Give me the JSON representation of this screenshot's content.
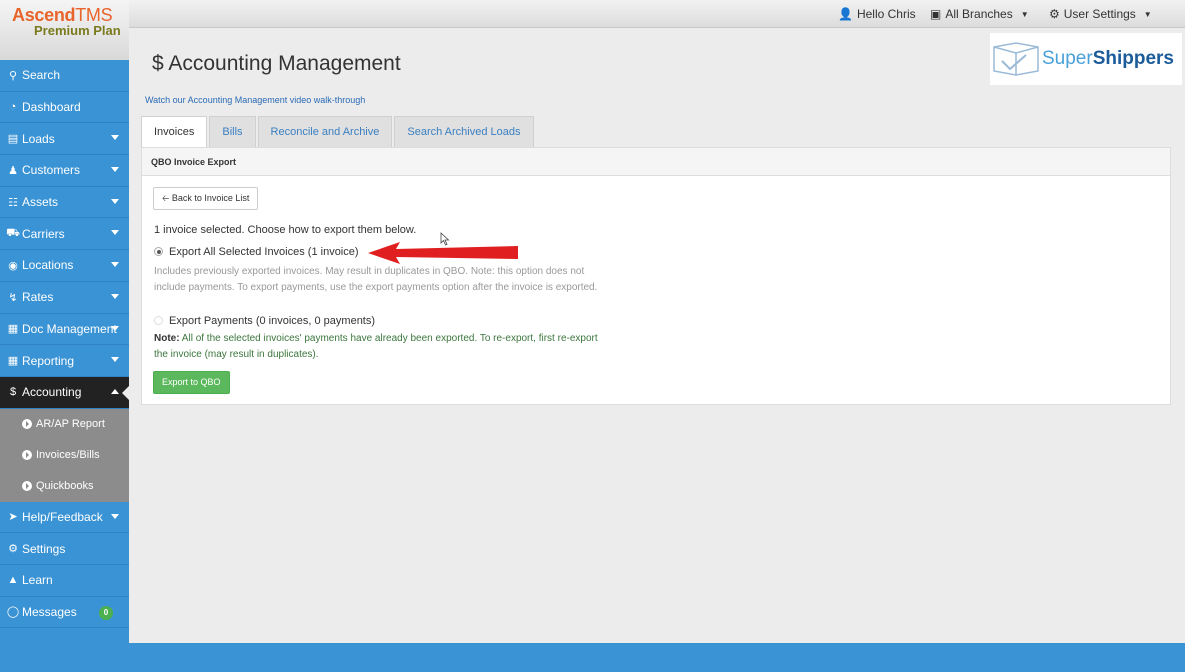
{
  "brand": {
    "name_main": "Ascend",
    "name_suffix": "TMS",
    "plan": "Premium Plan"
  },
  "topbar": {
    "greeting": "Hello Chris",
    "branches": "All Branches",
    "user_settings": "User Settings"
  },
  "sidebar": {
    "items": [
      {
        "label": "Search",
        "icon": "search-icon"
      },
      {
        "label": "Dashboard",
        "icon": "dashboard-icon"
      },
      {
        "label": "Loads",
        "icon": "list-icon"
      },
      {
        "label": "Customers",
        "icon": "users-icon"
      },
      {
        "label": "Assets",
        "icon": "barcode-icon"
      },
      {
        "label": "Carriers",
        "icon": "truck-icon"
      },
      {
        "label": "Locations",
        "icon": "map-marker-icon"
      },
      {
        "label": "Rates",
        "icon": "bolt-icon"
      },
      {
        "label": "Doc Management",
        "icon": "file-icon"
      },
      {
        "label": "Reporting",
        "icon": "report-icon"
      },
      {
        "label": "Accounting",
        "icon": "dollar-icon"
      }
    ],
    "sub_items": [
      {
        "label": "AR/AP Report"
      },
      {
        "label": "Invoices/Bills"
      },
      {
        "label": "Quickbooks"
      }
    ],
    "bottom_items": [
      {
        "label": "Help/Feedback",
        "icon": "bullhorn-icon"
      },
      {
        "label": "Settings",
        "icon": "gears-icon"
      },
      {
        "label": "Learn",
        "icon": "graduation-cap-icon"
      },
      {
        "label": "Messages",
        "icon": "comment-icon",
        "badge": "0"
      }
    ]
  },
  "main": {
    "title": "Accounting Management",
    "title_icon": "$",
    "partner_logo": {
      "part1": "Super",
      "part2": "Shippers"
    },
    "walkthrough_link": "Watch our Accounting Management video walk-through",
    "tabs": [
      {
        "label": "Invoices",
        "active": true
      },
      {
        "label": "Bills",
        "active": false
      },
      {
        "label": "Reconcile and Archive",
        "active": false
      },
      {
        "label": "Search Archived Loads",
        "active": false
      }
    ],
    "panel": {
      "heading": "QBO Invoice Export",
      "back_button": "Back to Invoice List",
      "selection_text": "1 invoice selected. Choose how to export them below.",
      "option1_label": "Export All Selected Invoices (1 invoice)",
      "option1_help": "Includes previously exported invoices. May result in duplicates in QBO. Note: this option does not include payments. To export payments, use the export payments option after the invoice is exported.",
      "option2_label": "Export Payments (0 invoices, 0 payments)",
      "option2_note_prefix": "Note:",
      "option2_note": "All of the selected invoices' payments have already been exported. To re-export, first re-export the invoice (may result in duplicates).",
      "export_button": "Export to QBO"
    }
  },
  "colors": {
    "sidebar": "#3a93d4",
    "active_nav": "#222222",
    "sub_nav": "#8c8c8c",
    "brand_orange": "#e8642b",
    "export_green": "#5cb85c",
    "arrow_red": "#e02020"
  }
}
